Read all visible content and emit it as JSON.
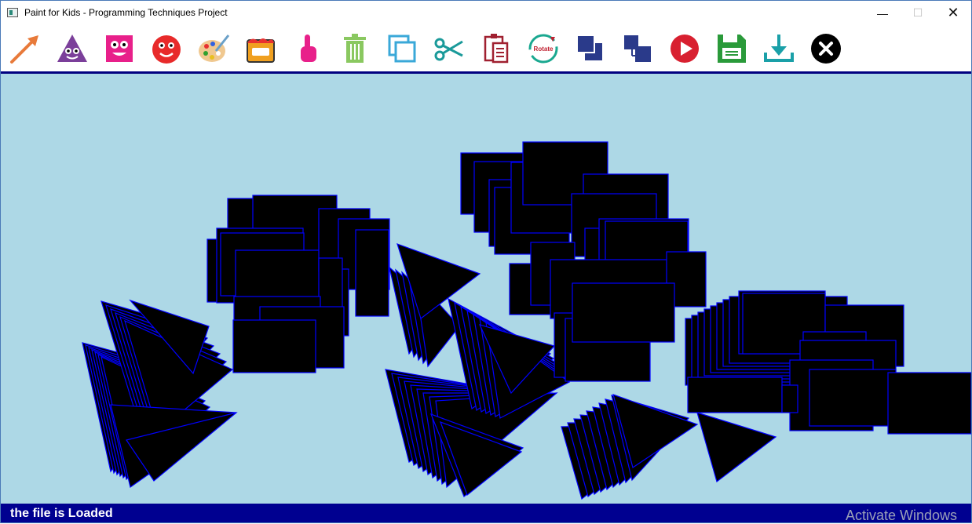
{
  "window": {
    "title": "Paint for Kids - Programming Techniques Project"
  },
  "title_controls": {
    "minimize_icon": "minimize-icon",
    "maximize_icon": "maximize-icon",
    "close_icon": "close-icon"
  },
  "toolbar": {
    "tools": [
      {
        "name": "line-tool-button",
        "icon": "arrow-icon"
      },
      {
        "name": "triangle-tool-button",
        "icon": "triangle-face-icon"
      },
      {
        "name": "rectangle-tool-button",
        "icon": "square-face-icon"
      },
      {
        "name": "circle-tool-button",
        "icon": "circle-face-icon"
      },
      {
        "name": "color-palette-button",
        "icon": "palette-icon"
      },
      {
        "name": "fill-bucket-button",
        "icon": "paint-bucket-icon"
      },
      {
        "name": "select-button",
        "icon": "pointer-finger-icon"
      },
      {
        "name": "delete-button",
        "icon": "trash-icon"
      },
      {
        "name": "copy-button",
        "icon": "copy-icon"
      },
      {
        "name": "cut-button",
        "icon": "scissors-icon"
      },
      {
        "name": "paste-button",
        "icon": "clipboard-icon"
      },
      {
        "name": "rotate-button",
        "icon": "rotate-icon"
      },
      {
        "name": "bring-to-front-button",
        "icon": "bring-front-icon"
      },
      {
        "name": "send-to-back-button",
        "icon": "send-back-icon"
      },
      {
        "name": "play-mode-button",
        "icon": "play-icon"
      },
      {
        "name": "save-button",
        "icon": "floppy-save-icon"
      },
      {
        "name": "load-button",
        "icon": "download-icon"
      },
      {
        "name": "exit-button",
        "icon": "exit-x-icon"
      }
    ],
    "rotate_label": "Rotate"
  },
  "canvas": {
    "background": "#add8e6",
    "shape_fill": "#000000",
    "shape_border": "#0000ff"
  },
  "status": {
    "message": "the file is Loaded",
    "watermark": "Activate Windows",
    "bar_color": "#000090"
  }
}
